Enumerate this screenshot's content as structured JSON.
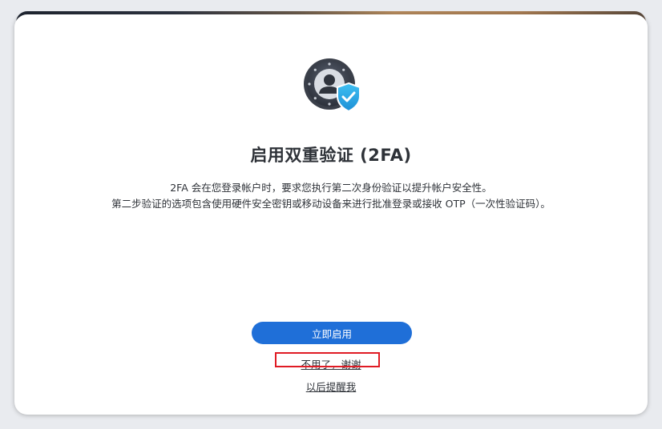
{
  "dialog": {
    "icon": "shield-user-2fa-icon",
    "title": "启用双重验证 (2FA)",
    "description_line1": "2FA 会在您登录帐户时，要求您执行第二次身份验证以提升帐户安全性。",
    "description_line2": "第二步验证的选项包含使用硬件安全密钥或移动设备来进行批准登录或接收 OTP（一次性验证码）。",
    "enable_button_label": "立即启用",
    "decline_link_label": "不用了，谢谢",
    "remind_later_link_label": "以后提醒我"
  },
  "colors": {
    "primary_button": "#1f6fd8",
    "text": "#2e3238",
    "badge_blue": "#2aa7e8",
    "highlight_box": "#e01b24"
  }
}
